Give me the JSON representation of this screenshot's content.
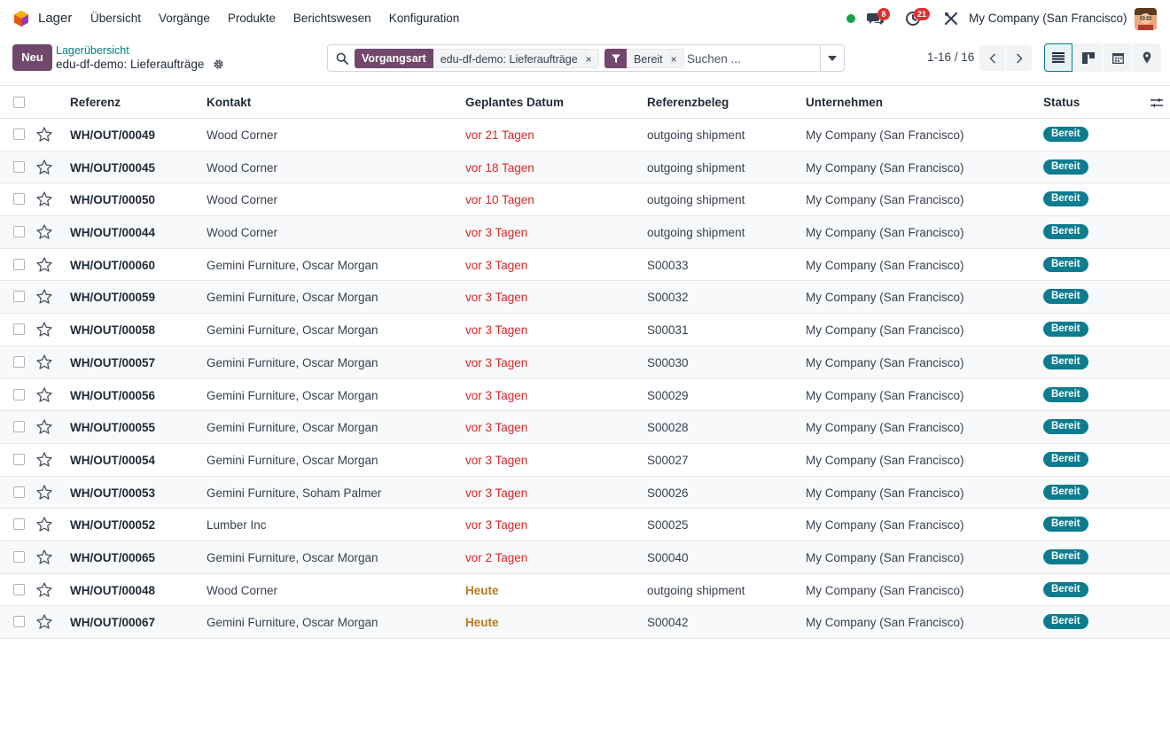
{
  "app": {
    "name": "Lager"
  },
  "menu": [
    "Übersicht",
    "Vorgänge",
    "Produkte",
    "Berichtswesen",
    "Konfiguration"
  ],
  "systray": {
    "chat_count": "8",
    "activity_count": "21",
    "company": "My Company (San Francisco)"
  },
  "control": {
    "new_label": "Neu",
    "breadcrumb_parent": "Lagerübersicht",
    "breadcrumb_current": "edu-df-demo: Lieferaufträge"
  },
  "search": {
    "facet1_label": "Vorgangsart",
    "facet1_value": "edu-df-demo: Lieferaufträge",
    "facet2_value": "Bereit",
    "remove": "×",
    "placeholder": "Suchen ..."
  },
  "pager": {
    "value": "1-16 / 16"
  },
  "colors": {
    "brand": "#71486b",
    "accent": "#017e84",
    "late": "#dc2626",
    "today": "#b7791f",
    "status": "#0d7c8f"
  },
  "table": {
    "headers": {
      "ref": "Referenz",
      "contact": "Kontakt",
      "date": "Geplantes Datum",
      "doc": "Referenzbeleg",
      "company": "Unternehmen",
      "status": "Status"
    },
    "rows": [
      {
        "ref": "WH/OUT/00049",
        "contact": "Wood Corner",
        "date": "vor 21 Tagen",
        "late": true,
        "doc": "outgoing shipment",
        "company": "My Company (San Francisco)",
        "status": "Bereit"
      },
      {
        "ref": "WH/OUT/00045",
        "contact": "Wood Corner",
        "date": "vor 18 Tagen",
        "late": true,
        "doc": "outgoing shipment",
        "company": "My Company (San Francisco)",
        "status": "Bereit"
      },
      {
        "ref": "WH/OUT/00050",
        "contact": "Wood Corner",
        "date": "vor 10 Tagen",
        "late": true,
        "doc": "outgoing shipment",
        "company": "My Company (San Francisco)",
        "status": "Bereit"
      },
      {
        "ref": "WH/OUT/00044",
        "contact": "Wood Corner",
        "date": "vor 3 Tagen",
        "late": true,
        "doc": "outgoing shipment",
        "company": "My Company (San Francisco)",
        "status": "Bereit"
      },
      {
        "ref": "WH/OUT/00060",
        "contact": "Gemini Furniture, Oscar Morgan",
        "date": "vor 3 Tagen",
        "late": true,
        "doc": "S00033",
        "company": "My Company (San Francisco)",
        "status": "Bereit"
      },
      {
        "ref": "WH/OUT/00059",
        "contact": "Gemini Furniture, Oscar Morgan",
        "date": "vor 3 Tagen",
        "late": true,
        "doc": "S00032",
        "company": "My Company (San Francisco)",
        "status": "Bereit"
      },
      {
        "ref": "WH/OUT/00058",
        "contact": "Gemini Furniture, Oscar Morgan",
        "date": "vor 3 Tagen",
        "late": true,
        "doc": "S00031",
        "company": "My Company (San Francisco)",
        "status": "Bereit"
      },
      {
        "ref": "WH/OUT/00057",
        "contact": "Gemini Furniture, Oscar Morgan",
        "date": "vor 3 Tagen",
        "late": true,
        "doc": "S00030",
        "company": "My Company (San Francisco)",
        "status": "Bereit"
      },
      {
        "ref": "WH/OUT/00056",
        "contact": "Gemini Furniture, Oscar Morgan",
        "date": "vor 3 Tagen",
        "late": true,
        "doc": "S00029",
        "company": "My Company (San Francisco)",
        "status": "Bereit"
      },
      {
        "ref": "WH/OUT/00055",
        "contact": "Gemini Furniture, Oscar Morgan",
        "date": "vor 3 Tagen",
        "late": true,
        "doc": "S00028",
        "company": "My Company (San Francisco)",
        "status": "Bereit"
      },
      {
        "ref": "WH/OUT/00054",
        "contact": "Gemini Furniture, Oscar Morgan",
        "date": "vor 3 Tagen",
        "late": true,
        "doc": "S00027",
        "company": "My Company (San Francisco)",
        "status": "Bereit"
      },
      {
        "ref": "WH/OUT/00053",
        "contact": "Gemini Furniture, Soham Palmer",
        "date": "vor 3 Tagen",
        "late": true,
        "doc": "S00026",
        "company": "My Company (San Francisco)",
        "status": "Bereit"
      },
      {
        "ref": "WH/OUT/00052",
        "contact": "Lumber Inc",
        "date": "vor 3 Tagen",
        "late": true,
        "doc": "S00025",
        "company": "My Company (San Francisco)",
        "status": "Bereit"
      },
      {
        "ref": "WH/OUT/00065",
        "contact": "Gemini Furniture, Oscar Morgan",
        "date": "vor 2 Tagen",
        "late": true,
        "doc": "S00040",
        "company": "My Company (San Francisco)",
        "status": "Bereit"
      },
      {
        "ref": "WH/OUT/00048",
        "contact": "Wood Corner",
        "date": "Heute",
        "late": false,
        "doc": "outgoing shipment",
        "company": "My Company (San Francisco)",
        "status": "Bereit"
      },
      {
        "ref": "WH/OUT/00067",
        "contact": "Gemini Furniture, Oscar Morgan",
        "date": "Heute",
        "late": false,
        "doc": "S00042",
        "company": "My Company (San Francisco)",
        "status": "Bereit"
      }
    ]
  }
}
